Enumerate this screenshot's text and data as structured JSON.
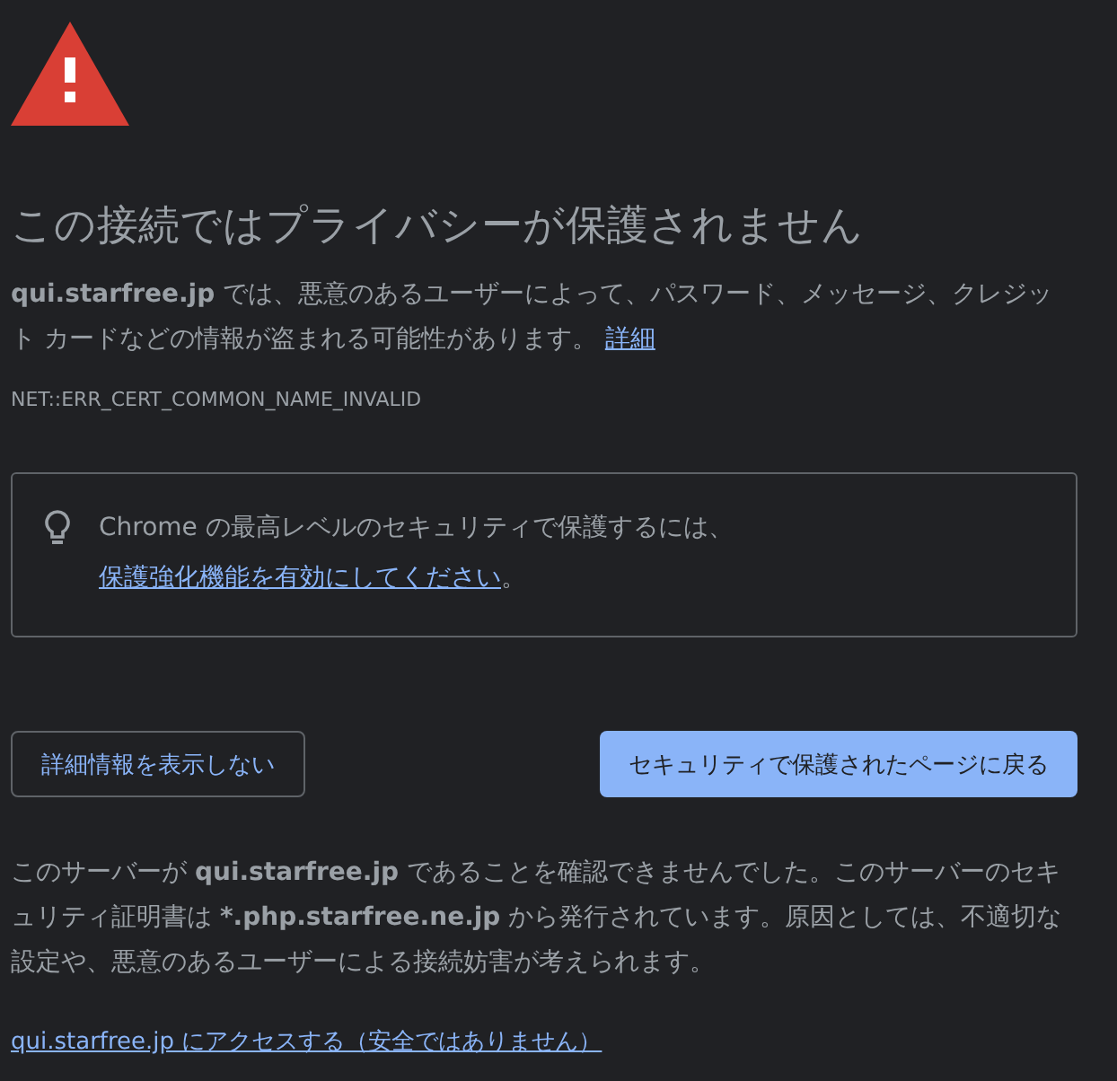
{
  "heading": "この接続ではプライバシーが保護されません",
  "message": {
    "text": "**qui.starfree.jp** では、悪意のあるユーザーによって、パスワード、メッセージ、クレジット カードなどの情報が盗まれる可能性があります。",
    "link": "詳細"
  },
  "error_code": "NET::ERR_CERT_COMMON_NAME_INVALID",
  "tip": {
    "text": "Chrome の最高レベルのセキュリティで保護するには、",
    "link": "保護強化機能を有効にしてください",
    "suffix": "。"
  },
  "buttons": [
    {
      "label": "詳細情報を表示しない",
      "kind": "secondary"
    },
    {
      "label": "セキュリティで保護されたページに戻る",
      "kind": "primary"
    }
  ],
  "details": "このサーバーが **qui.starfree.jp** であることを確認できませんでした。このサーバーのセキュリティ証明書は ***.php.starfree.ne.jp** から発行されています。原因としては、不適切な設定や、悪意のあるユーザーによる接続妨害が考えられます。",
  "proceed_link": "qui.starfree.jp にアクセスする（安全ではありません）"
}
